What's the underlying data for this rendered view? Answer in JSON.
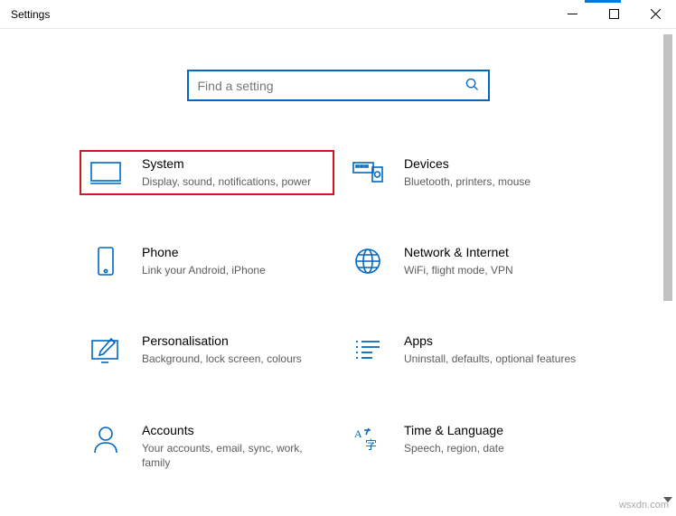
{
  "window": {
    "title": "Settings"
  },
  "search": {
    "placeholder": "Find a setting"
  },
  "tiles": {
    "system": {
      "title": "System",
      "desc": "Display, sound, notifications, power"
    },
    "devices": {
      "title": "Devices",
      "desc": "Bluetooth, printers, mouse"
    },
    "phone": {
      "title": "Phone",
      "desc": "Link your Android, iPhone"
    },
    "network": {
      "title": "Network & Internet",
      "desc": "WiFi, flight mode, VPN"
    },
    "personalisation": {
      "title": "Personalisation",
      "desc": "Background, lock screen, colours"
    },
    "apps": {
      "title": "Apps",
      "desc": "Uninstall, defaults, optional features"
    },
    "accounts": {
      "title": "Accounts",
      "desc": "Your accounts, email, sync, work, family"
    },
    "time": {
      "title": "Time & Language",
      "desc": "Speech, region, date"
    }
  },
  "watermark": "wsxdn.com"
}
